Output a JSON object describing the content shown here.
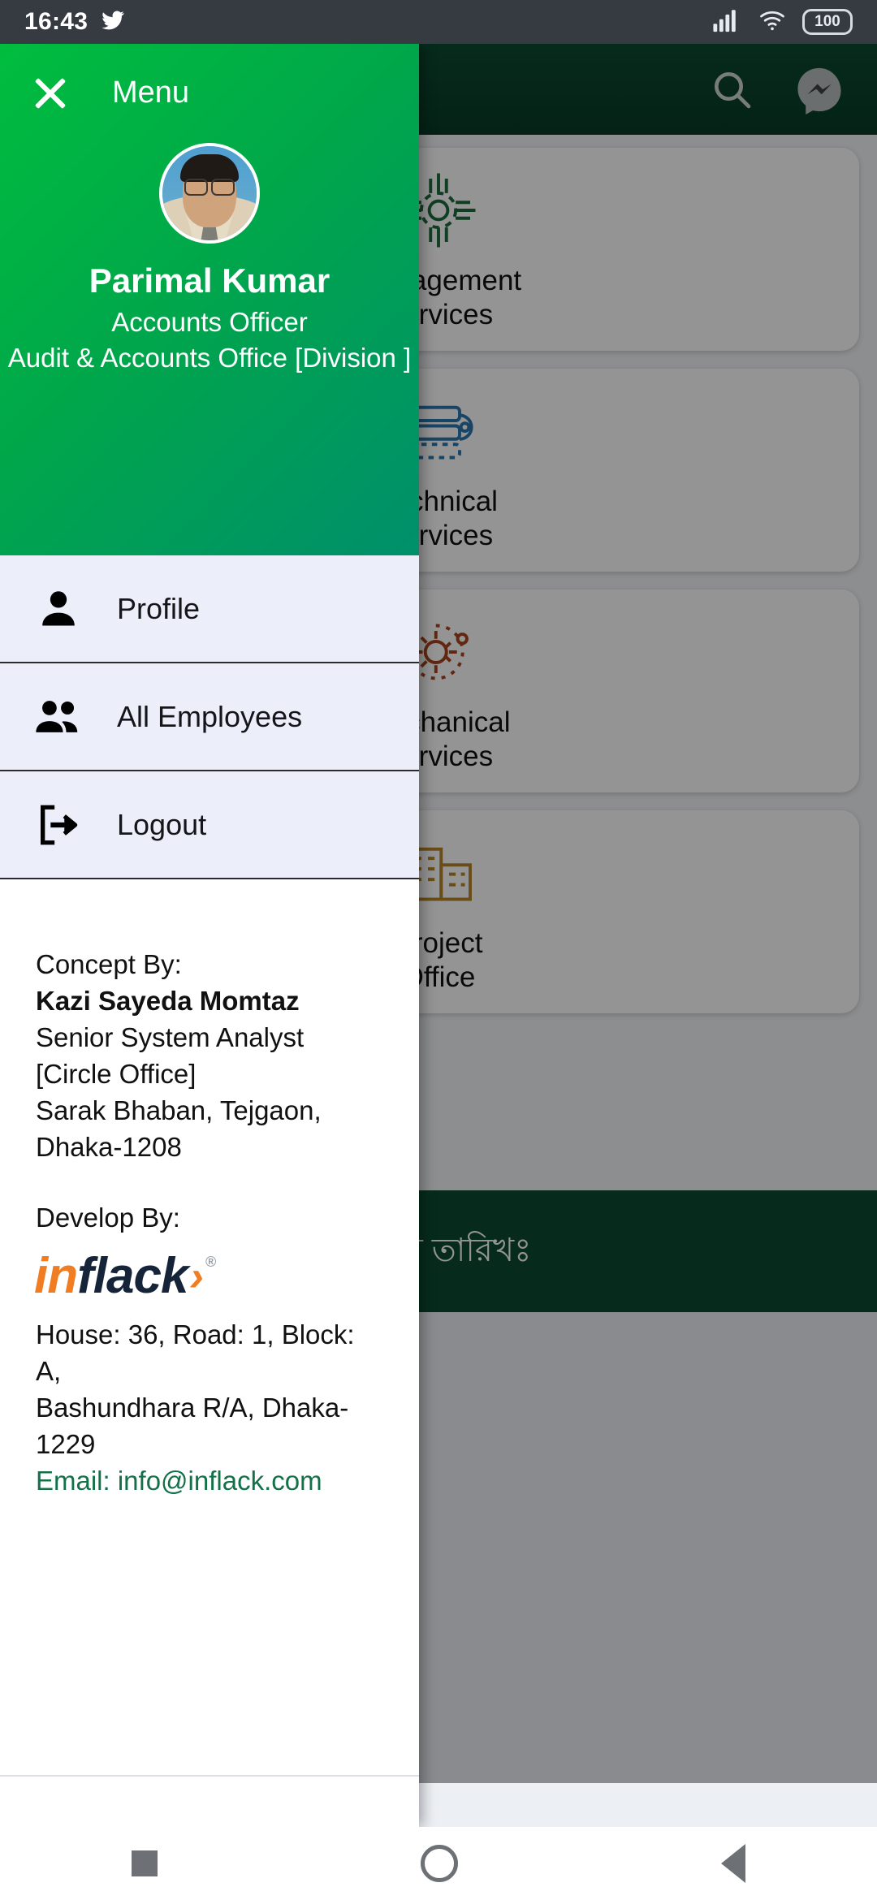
{
  "status_bar": {
    "time": "16:43",
    "twitter_icon": "twitter-bird-icon",
    "signal_icon": "cellular-signal-icon",
    "wifi_icon": "wifi-icon",
    "battery_level": "100"
  },
  "background_app": {
    "appbar": {
      "search_icon": "search-icon",
      "messenger_icon": "messenger-icon",
      "background_color": "#0c4a31"
    },
    "cards": [
      {
        "label": "Management\nServices",
        "icon": "roundabout-network-icon",
        "icon_color": "#1d6b3c"
      },
      {
        "label": "Technical\nServices",
        "icon": "book-wrench-icon",
        "icon_color": "#2a77ae"
      },
      {
        "label": "Mechanical\nServices",
        "icon": "gear-orbit-icon",
        "icon_color": "#a8441c"
      },
      {
        "label": "Project\nOffice",
        "icon": "buildings-icon",
        "icon_color": "#b5862a"
      }
    ],
    "banner_text": "র শেষ তারিখঃ"
  },
  "drawer": {
    "close_icon": "close-icon",
    "title": "Menu",
    "profile": {
      "avatar": "user-photo-avatar",
      "name": "Parimal Kumar",
      "designation": "Accounts Officer",
      "office": "Audit & Accounts Office [Division ]"
    },
    "menu_items": [
      {
        "label": "Profile",
        "icon": "person-icon"
      },
      {
        "label": "All Employees",
        "icon": "people-group-icon"
      },
      {
        "label": "Logout",
        "icon": "logout-icon"
      }
    ],
    "footer": {
      "concept_label": "Concept By:",
      "concept_name": "Kazi Sayeda Momtaz",
      "concept_title": "Senior System Analyst [Circle Office]",
      "concept_address": "Sarak Bhaban, Tejgaon, Dhaka-1208",
      "develop_label": "Develop By:",
      "logo": {
        "part1": "in",
        "part2": "flack",
        "chevron": "›",
        "registered": "®"
      },
      "address_line1": "House: 36, Road: 1, Block: A,",
      "address_line2": "Bashundhara R/A, Dhaka-1229",
      "email": "Email: info@inflack.com",
      "email_color": "#147048"
    }
  },
  "nav_bar": {
    "recents_icon": "square-recents-icon",
    "home_icon": "circle-home-icon",
    "back_icon": "triangle-back-icon"
  }
}
